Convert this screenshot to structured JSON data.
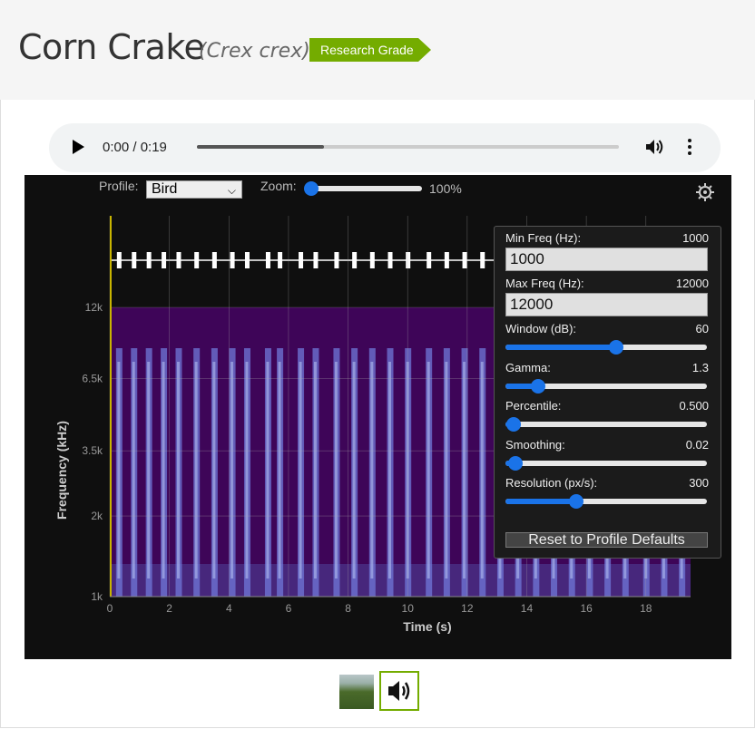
{
  "header": {
    "common_name": "Corn Crake",
    "scientific_name": "(Crex crex)",
    "quality_badge": "Research Grade",
    "badge_color": "#74ac00"
  },
  "audio_player": {
    "time": "0:00 / 0:19",
    "progress_fraction": 0.3,
    "play_icon": "play-icon",
    "volume_icon": "volume-icon",
    "more_icon": "more-vertical-icon"
  },
  "spectrogram": {
    "profile_label": "Profile:",
    "profile_value": "Bird",
    "zoom_label": "Zoom:",
    "zoom_value": "100%",
    "zoom_fraction": 0.0,
    "settings_icon": "gear-icon"
  },
  "chart_data": {
    "type": "heatmap",
    "xlabel": "Time (s)",
    "ylabel": "Frequency (kHz)",
    "xticks": [
      "0",
      "2",
      "4",
      "6",
      "8",
      "10",
      "12",
      "14",
      "16",
      "18"
    ],
    "x_tick_values": [
      0,
      2,
      4,
      6,
      8,
      10,
      12,
      14,
      16,
      18
    ],
    "yticks": [
      "1k",
      "2k",
      "3.5k",
      "6.5k",
      "12k"
    ],
    "y_tick_values": [
      1,
      2,
      3.5,
      6.5,
      12
    ],
    "xlim": [
      0,
      19.5
    ],
    "ylim_khz": [
      1,
      12
    ],
    "y_scale": "log",
    "grid": true,
    "colormap_bg": "#3e0558",
    "call_times": [
      0.3,
      0.8,
      1.3,
      1.8,
      2.3,
      2.9,
      3.5,
      4.1,
      4.6,
      5.3,
      5.7,
      6.4,
      6.9,
      7.6,
      8.2,
      8.8,
      9.4,
      10.0,
      10.7,
      11.3,
      11.9,
      12.5,
      13.1,
      13.7,
      14.3,
      14.9,
      15.5,
      16.1,
      16.7,
      17.3,
      18.0,
      18.6,
      19.2
    ]
  },
  "settings_panel": {
    "min_freq_label": "Min Freq (Hz):",
    "min_freq_value": "1000",
    "min_freq_input": "1000",
    "max_freq_label": "Max Freq (Hz):",
    "max_freq_value": "12000",
    "max_freq_input": "12000",
    "window_label": "Window (dB):",
    "window_value": "60",
    "window_fraction": 0.55,
    "gamma_label": "Gamma:",
    "gamma_value": "1.3",
    "gamma_fraction": 0.16,
    "percentile_label": "Percentile:",
    "percentile_value": "0.500",
    "percentile_fraction": 0.04,
    "smoothing_label": "Smoothing:",
    "smoothing_value": "0.02",
    "smoothing_fraction": 0.05,
    "resolution_label": "Resolution (px/s):",
    "resolution_value": "300",
    "resolution_fraction": 0.35,
    "reset_label": "Reset to Profile Defaults"
  },
  "media_strip": {
    "photo_icon": "photo-thumbnail",
    "sound_icon": "speaker-icon"
  }
}
